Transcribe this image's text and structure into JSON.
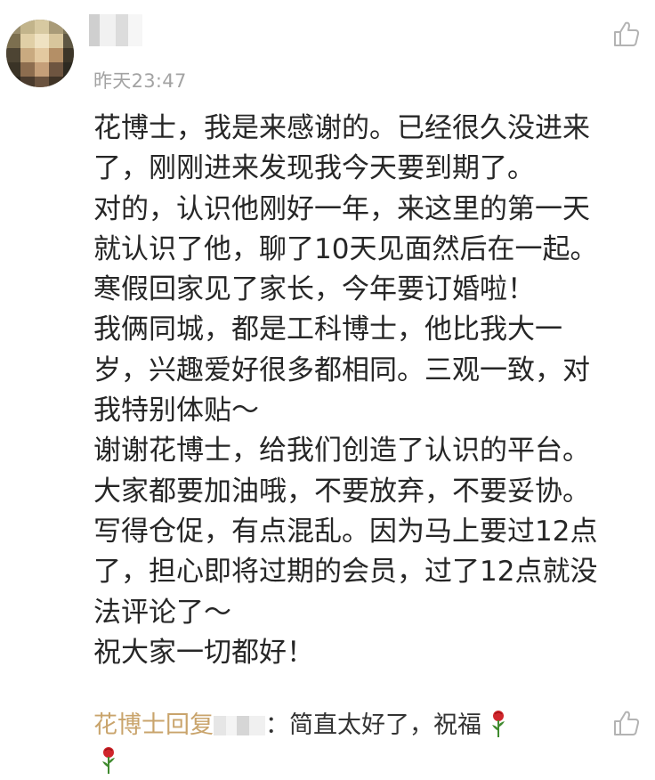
{
  "comment": {
    "timestamp": "昨天23:47",
    "body_lines": [
      "花博士，我是来感谢的。已经很久没进来",
      "了，刚刚进来发现我今天要到期了。",
      "对的，认识他刚好一年，来这里的第一天",
      "就认识了他，聊了10天见面然后在一起。",
      "寒假回家见了家长，今年要订婚啦！",
      "我俩同城，都是工科博士，他比我大一",
      "岁，兴趣爱好很多都相同。三观一致，对",
      "我特别体贴～",
      "谢谢花博士，给我们创造了认识的平台。",
      "大家都要加油哦，不要放弃，不要妥协。",
      "写得仓促，有点混乱。因为马上要过12点",
      "了，担心即将过期的会员，过了12点就没",
      "法评论了～",
      "祝大家一切都好！"
    ]
  },
  "reply": {
    "author": "花博士",
    "verb": "回复",
    "colon": "：",
    "text": "简直太好了，祝福"
  },
  "icons": {
    "like": "thumbs-up-icon",
    "emoji": "rose-icon"
  },
  "colors": {
    "body_text": "#262626",
    "timestamp": "#a3a3a3",
    "reply_author": "#c9a46c",
    "icon_gray": "#b3b3b3",
    "rose_red": "#d0262c",
    "rose_green": "#3f8a2e"
  }
}
